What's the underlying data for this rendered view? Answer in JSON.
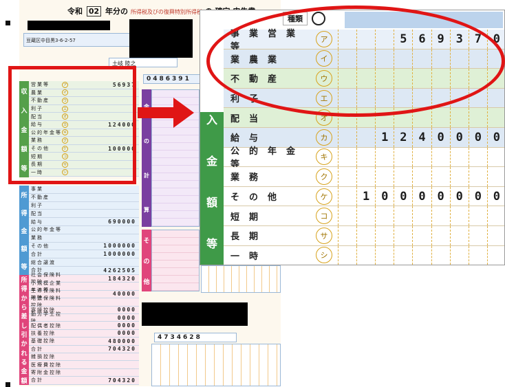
{
  "form": {
    "era_label": "令和",
    "year": "02",
    "title": "年分の",
    "title_small": "所得税及びの復興特別所得税",
    "title_suffix": "の 確定 申告書",
    "address": "豆蔵区中目黒3-6-2-57",
    "name": "土岐 陸之",
    "phone": "0486391",
    "kind_label": "種類",
    "income_side_chars": [
      "収",
      "入",
      "金",
      "額",
      "等"
    ],
    "income_rows": [
      {
        "label": "営業等",
        "circle": "ア",
        "value": "56937"
      },
      {
        "label": "農業",
        "circle": "イ",
        "value": ""
      },
      {
        "label": "不動産",
        "circle": "ウ",
        "value": ""
      },
      {
        "label": "利子",
        "circle": "エ",
        "value": ""
      },
      {
        "label": "配当",
        "circle": "オ",
        "value": ""
      },
      {
        "label": "給与",
        "circle": "カ",
        "value": "124000"
      },
      {
        "label": "公的年金等",
        "circle": "キ",
        "value": ""
      },
      {
        "label": "業務",
        "circle": "ク",
        "value": ""
      },
      {
        "label": "その他",
        "circle": "ケ",
        "value": "100000"
      },
      {
        "label": "短期",
        "circle": "コ",
        "value": ""
      },
      {
        "label": "長期",
        "circle": "サ",
        "value": ""
      },
      {
        "label": "一時",
        "circle": "シ",
        "value": ""
      }
    ],
    "income_side2_chars": [
      "所",
      "得",
      "金",
      "額",
      "等"
    ],
    "income2_rows": [
      {
        "label": "事業",
        "value": ""
      },
      {
        "label": "不動産",
        "value": ""
      },
      {
        "label": "利子",
        "value": ""
      },
      {
        "label": "配当",
        "value": ""
      },
      {
        "label": "給与",
        "value": "690000"
      },
      {
        "label": "公的年金等",
        "value": ""
      },
      {
        "label": "業務",
        "value": ""
      },
      {
        "label": "その他",
        "value": "1000000"
      },
      {
        "label": "合計",
        "value": "1000000"
      },
      {
        "label": "総合譲渡",
        "value": ""
      },
      {
        "label": "合計",
        "value": "4262505"
      }
    ],
    "deduction_side_chars": [
      "所",
      "得",
      "か",
      "ら",
      "差",
      "し",
      "引",
      "か",
      "れ",
      "る",
      "金",
      "額"
    ],
    "deduction_rows": [
      {
        "label": "社会保険料控除",
        "value": "184320"
      },
      {
        "label": "小規模企業共済等",
        "value": ""
      },
      {
        "label": "生命保険料控除",
        "value": "40000"
      },
      {
        "label": "地震保険料控除",
        "value": ""
      },
      {
        "label": "寡婦控除",
        "value": "0000"
      },
      {
        "label": "勤労学生控除",
        "value": "0000"
      },
      {
        "label": "配偶者控除",
        "value": "0000"
      },
      {
        "label": "扶養控除",
        "value": "0000"
      },
      {
        "label": "基礎控除",
        "value": "480000"
      },
      {
        "label": "合計",
        "value": "704320"
      },
      {
        "label": "雑損控除",
        "value": ""
      },
      {
        "label": "医療費控除",
        "value": ""
      },
      {
        "label": "寄附金控除",
        "value": ""
      },
      {
        "label": "合計",
        "value": "704320"
      }
    ],
    "tax_side_chars": [
      "金",
      "の",
      "計",
      "算"
    ],
    "other_side_chars": [
      "そ",
      "の",
      "他"
    ],
    "mid_value": "4734628"
  },
  "zoom": {
    "header_label": "種類",
    "side_chars": [
      "収",
      "入",
      "金",
      "額",
      "等"
    ],
    "rows": [
      {
        "label": "事業営業等",
        "circle": "ア",
        "digits": [
          "",
          "",
          "",
          "5",
          "6",
          "9",
          "3",
          "7",
          "0"
        ]
      },
      {
        "label": "業農業",
        "circle": "イ",
        "digits": [
          "",
          "",
          "",
          "",
          "",
          "",
          "",
          "",
          ""
        ]
      },
      {
        "label": "不動産",
        "circle": "ウ",
        "digits": [
          "",
          "",
          "",
          "",
          "",
          "",
          "",
          "",
          ""
        ]
      },
      {
        "label": "利子",
        "circle": "エ",
        "digits": [
          "",
          "",
          "",
          "",
          "",
          "",
          "",
          "",
          ""
        ]
      },
      {
        "label": "配当",
        "circle": "オ",
        "digits": [
          "",
          "",
          "",
          "",
          "",
          "",
          "",
          "",
          ""
        ]
      },
      {
        "label": "給与",
        "circle": "カ",
        "digits": [
          "",
          "",
          "1",
          "2",
          "4",
          "0",
          "0",
          "0",
          "0"
        ]
      },
      {
        "label": "公的年金等",
        "circle": "キ",
        "digits": [
          "",
          "",
          "",
          "",
          "",
          "",
          "",
          "",
          ""
        ]
      },
      {
        "label": "業務",
        "circle": "ク",
        "digits": [
          "",
          "",
          "",
          "",
          "",
          "",
          "",
          "",
          ""
        ]
      },
      {
        "label": "その他",
        "circle": "ケ",
        "digits": [
          "",
          "1",
          "0",
          "0",
          "0",
          "0",
          "0",
          "0",
          "0"
        ]
      },
      {
        "label": "短期",
        "circle": "コ",
        "digits": [
          "",
          "",
          "",
          "",
          "",
          "",
          "",
          "",
          ""
        ]
      },
      {
        "label": "長期",
        "circle": "サ",
        "digits": [
          "",
          "",
          "",
          "",
          "",
          "",
          "",
          "",
          ""
        ]
      },
      {
        "label": "一時",
        "circle": "シ",
        "digits": [
          "",
          "",
          "",
          "",
          "",
          "",
          "",
          "",
          ""
        ]
      }
    ]
  },
  "colors": {
    "highlight": "#e01515",
    "income_green": "#3f9a48",
    "deduction_pink": "#e0457b",
    "other_purple": "#7a3fa0"
  }
}
